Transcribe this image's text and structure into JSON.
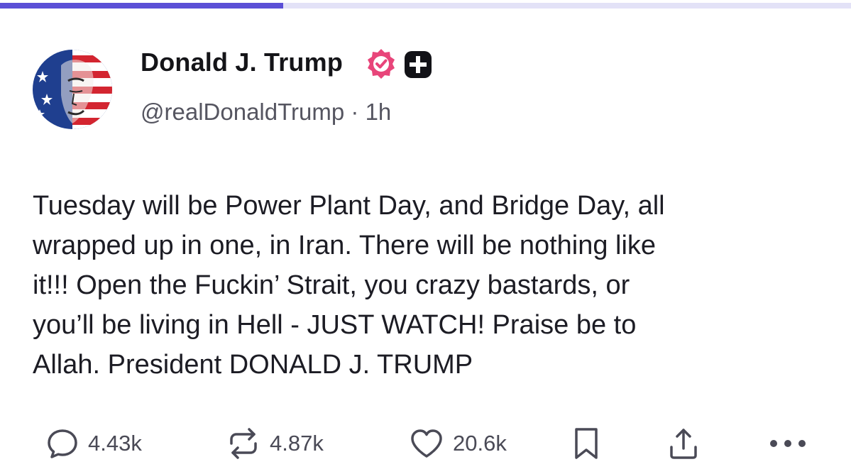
{
  "progress": {
    "fraction": 0.333
  },
  "author": {
    "display_name": "Donald J. Trump",
    "handle": "@realDonaldTrump",
    "separator": "·",
    "time_ago": "1h",
    "badge_icon": "verified-badge-icon",
    "plus_icon": "plus-badge-icon",
    "badge_color": "#e8457a"
  },
  "post": {
    "lines": [
      "Tuesday will be Power Plant Day, and Bridge Day, all",
      "wrapped up in one, in Iran. There will be nothing like",
      "it!!! Open the Fuckin’ Strait, you crazy bastards, or",
      "you’ll be living in Hell - JUST WATCH! Praise be to",
      "Allah. President DONALD J. TRUMP"
    ]
  },
  "actions": {
    "reply": {
      "icon": "reply-icon",
      "count": "4.43k"
    },
    "repost": {
      "icon": "repost-icon",
      "count": "4.87k"
    },
    "like": {
      "icon": "heart-icon",
      "count": "20.6k"
    },
    "bookmark": {
      "icon": "bookmark-icon"
    },
    "share": {
      "icon": "share-icon"
    },
    "more": {
      "icon": "more-icon"
    }
  }
}
